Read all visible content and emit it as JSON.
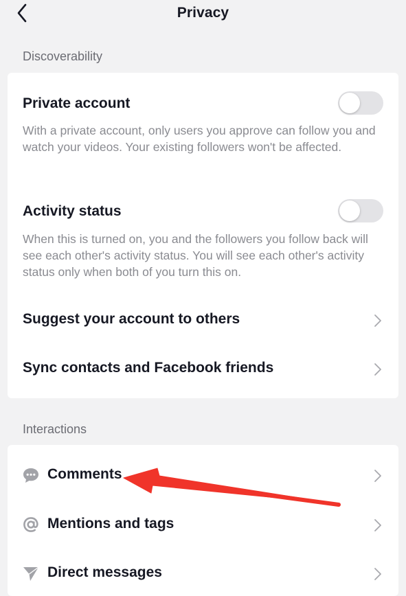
{
  "header": {
    "title": "Privacy",
    "back_icon": "chevron-left-icon"
  },
  "discoverability": {
    "section_label": "Discoverability",
    "private_account": {
      "title": "Private account",
      "description": "With a private account, only users you approve can follow you and watch your videos. Your existing followers won't be affected.",
      "toggle_on": false
    },
    "activity_status": {
      "title": "Activity status",
      "description": "When this is turned on, you and the followers you follow back will see each other's activity status. You will see each other's activity status only when both of you turn this on.",
      "toggle_on": false
    },
    "suggest_account": {
      "label": "Suggest your account to others"
    },
    "sync_contacts": {
      "label": "Sync contacts and Facebook friends"
    }
  },
  "interactions": {
    "section_label": "Interactions",
    "items": [
      {
        "label": "Comments",
        "icon": "comment-bubble-icon"
      },
      {
        "label": "Mentions and tags",
        "icon": "at-sign-icon"
      },
      {
        "label": "Direct messages",
        "icon": "paper-plane-icon"
      }
    ]
  },
  "colors": {
    "background": "#f2f2f3",
    "card": "#ffffff",
    "text_primary": "#161823",
    "text_secondary": "#8a8b91",
    "toggle_off": "#e3e3e6",
    "annotation_arrow": "#f0342a"
  }
}
